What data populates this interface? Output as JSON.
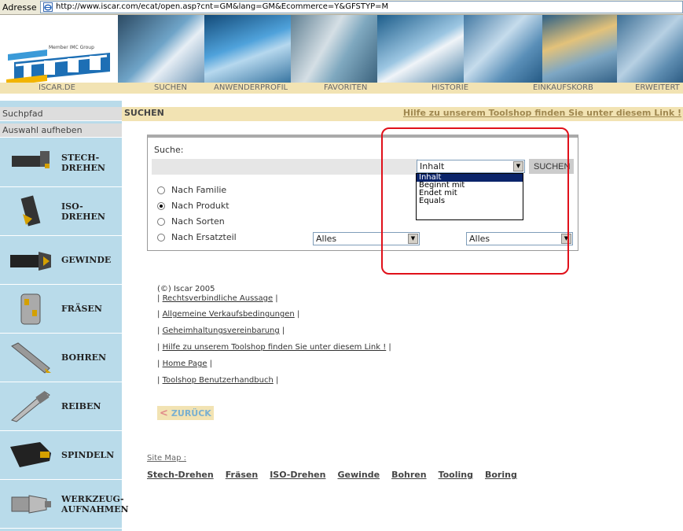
{
  "address_bar": {
    "label": "Adresse",
    "url": "http://www.iscar.com/ecat/open.asp?cnt=GM&lang=GM&Ecommerce=Y&GFSTYP=M"
  },
  "banner": {
    "logo_tagline": "Member IMC Group"
  },
  "nav": [
    "ISCAR.DE",
    "SUCHEN",
    "ANWENDERPROFIL",
    "FAVORITEN",
    "HISTORIE",
    "EINKAUFSKORB",
    "ERWEITERT"
  ],
  "sidebar": {
    "path_label": "Suchpfad",
    "clear_label": "Auswahl aufheben",
    "categories": [
      {
        "label": "STECH-\nDREHEN",
        "icon": "grooving-tool-icon"
      },
      {
        "label": "ISO-\nDREHEN",
        "icon": "iso-turning-tool-icon"
      },
      {
        "label": "GEWINDE",
        "icon": "threading-tool-icon"
      },
      {
        "label": "FRÄSEN",
        "icon": "milling-cutter-icon"
      },
      {
        "label": "BOHREN",
        "icon": "drill-icon"
      },
      {
        "label": "REIBEN",
        "icon": "reamer-icon"
      },
      {
        "label": "SPINDELN",
        "icon": "spindle-icon"
      },
      {
        "label": "WERKZEUG-\nAUFNAHMEN",
        "icon": "tool-holder-icon"
      }
    ]
  },
  "breadcrumb": {
    "title": "SUCHEN",
    "help_link": "Hilfe zu unserem Toolshop finden Sie unter diesem Link !"
  },
  "search": {
    "label": "Suche:",
    "input_value": "",
    "select_value": "Inhalt",
    "button": "SUCHEN",
    "dropdown_options": [
      "Inhalt",
      "Beginnt mit",
      "Endet mit",
      "Equals"
    ],
    "dropdown_selected": "Inhalt",
    "radios": [
      {
        "label": "Nach Familie",
        "checked": false
      },
      {
        "label": "Nach Produkt",
        "checked": true
      },
      {
        "label": "Nach Sorten",
        "checked": false
      },
      {
        "label": "Nach Ersatzteil",
        "checked": false
      }
    ],
    "filter1": "Alles",
    "filter2": "Alles"
  },
  "footer": {
    "copyright": "(©) Iscar 2005",
    "links": [
      "Rechtsverbindliche Aussage",
      "Allgemeine Verkaufsbedingungen",
      "Geheimhaltungsvereinbarung",
      "Hilfe zu unserem Toolshop finden Sie unter diesem Link !",
      "Home Page",
      "Toolshop Benutzerhandbuch"
    ]
  },
  "back_button": "ZURÜCK",
  "sitemap": {
    "label": "Site Map :",
    "links": [
      "Stech-Drehen",
      "Fräsen",
      "ISO-Drehen",
      "Gewinde",
      "Bohren",
      "Tooling",
      "Boring"
    ]
  },
  "colors": {
    "accent_tan": "#f2e3b3",
    "sidebar_blue": "#b9dbea",
    "highlight_red": "#e0101a",
    "banner_blue": "#1a6fa8"
  }
}
